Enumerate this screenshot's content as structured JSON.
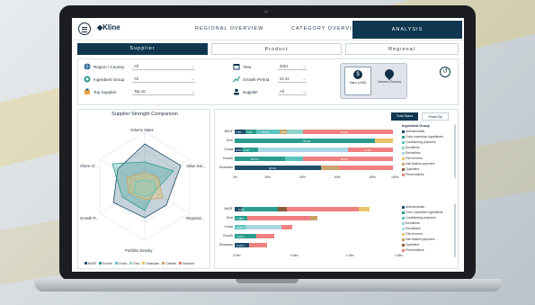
{
  "header": {
    "logo": "Kline",
    "tabs": [
      "REGIONAL OVERVIEW",
      "CATEGORY OVERVIEW",
      "ANALYSIS"
    ]
  },
  "subtabs": [
    "Supplier",
    "Product",
    "Regional"
  ],
  "filters": {
    "region_label": "Region / Country",
    "region_value": "All",
    "ingredient_label": "Ingredient Group",
    "ingredient_value": "All",
    "top_supplier_label": "Top Supplier",
    "top_supplier_value": "Top 10",
    "year_label": "Year",
    "year_value": "2021",
    "growth_label": "Growth Period",
    "growth_value": "21-22",
    "supplier_label": "Supplier",
    "supplier_value": "All",
    "value_toggle": "Value (USD)",
    "volume_toggle": "Volume (Tonnes)"
  },
  "radar": {
    "title": "Supplier Strength Comparison",
    "axes": [
      "Volume Sales",
      "Value Sal...",
      "Regional...",
      "Portfolio Density",
      "Growth P...",
      "Share of..."
    ],
    "legend": [
      "BASF",
      "Evonik",
      "Croda",
      "Dow",
      "Givaudan",
      "Clariant",
      "Ashland"
    ],
    "legend_colors": [
      "#1f4e6b",
      "#2a9d8f",
      "#5ec4c0",
      "#8fd3c9",
      "#e9c46a",
      "#c9a36b",
      "#e07a5f"
    ]
  },
  "bars": {
    "btn_dark": "Total Sales",
    "btn_light": "Share By",
    "top_categories": [
      "BASF",
      "Dow",
      "Croda",
      "Evonik",
      "Givaudan"
    ],
    "top_ticks": [
      "0%",
      "20%",
      "40%",
      "60%",
      "80%",
      "100%"
    ],
    "bottom_categories": [
      "BASF",
      "Dow",
      "Croda",
      "Evonik",
      "Givaudan"
    ],
    "bottom_ticks": [
      "0.0bn",
      "0.5bn",
      "1.0bn",
      "1.5bn"
    ],
    "top_labels": [
      [
        "7.8%",
        "7.0%",
        "15.5%",
        "4.9%",
        "46.4%"
      ],
      [
        "78.6%",
        "",
        "",
        "",
        ""
      ],
      [
        "3.5%",
        "8.3%",
        "",
        "73.5%",
        ""
      ],
      [
        "28.1%",
        "",
        "",
        "46.2%",
        ""
      ],
      [
        "48.4%",
        "",
        "",
        "",
        ""
      ]
    ],
    "bottom_labels": [
      "0.9bn",
      "0.48bn",
      "0.42bn",
      "0.27bn",
      "0.17bn"
    ]
  },
  "legend_title": "Ingredient Group",
  "legend_items": [
    "Antimicrobials",
    "Color cosmetics ingredients",
    "Conditioning polymers",
    "Emollients",
    "Emulsifiers",
    "Film formers",
    "Hair fixative polymers",
    "Opacifiers",
    "Preservatives"
  ],
  "legend_colors": [
    "#1f4e6b",
    "#2a9d8f",
    "#5ec4c0",
    "#8fd3c9",
    "#a8d8e6",
    "#e9c46a",
    "#c9a36b",
    "#8b5a3c",
    "#f08080"
  ],
  "legend_items_bottom": [
    "Antimicrobials",
    "Color cosmetics ingredients",
    "Conditioning polymers",
    "Emollients",
    "Emulsifiers",
    "Film formers",
    "Hair fixative polymers",
    "Opacifiers",
    "Preservatives"
  ]
}
